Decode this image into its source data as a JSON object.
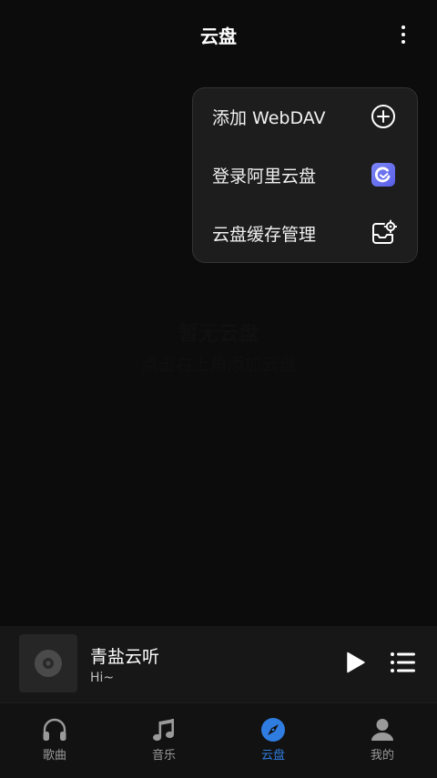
{
  "header": {
    "title": "云盘",
    "more_icon": "more-vertical-icon"
  },
  "menu": {
    "items": [
      {
        "label": "添加 WebDAV",
        "icon": "add-circle-icon"
      },
      {
        "label": "登录阿里云盘",
        "icon": "aliyun-drive-icon",
        "icon_color": "#6a73f0"
      },
      {
        "label": "云盘缓存管理",
        "icon": "cache-settings-icon"
      }
    ]
  },
  "empty_state": {
    "title": "暂无云盘",
    "subtitle": "点击右上角添加云盘"
  },
  "player": {
    "title": "青盐云听",
    "subtitle": "Hi~",
    "album_icon": "disc-icon",
    "play_icon": "play-icon",
    "playlist_icon": "playlist-icon"
  },
  "tabs": [
    {
      "label": "歌曲",
      "icon": "headphones-icon",
      "active": false
    },
    {
      "label": "音乐",
      "icon": "music-note-icon",
      "active": false
    },
    {
      "label": "云盘",
      "icon": "compass-icon",
      "active": true
    },
    {
      "label": "我的",
      "icon": "person-icon",
      "active": false
    }
  ],
  "colors": {
    "background": "#0c0c0c",
    "menu_background": "#1d1d1d",
    "accent": "#2f7de0",
    "inactive_tab": "#9a9a9a"
  }
}
